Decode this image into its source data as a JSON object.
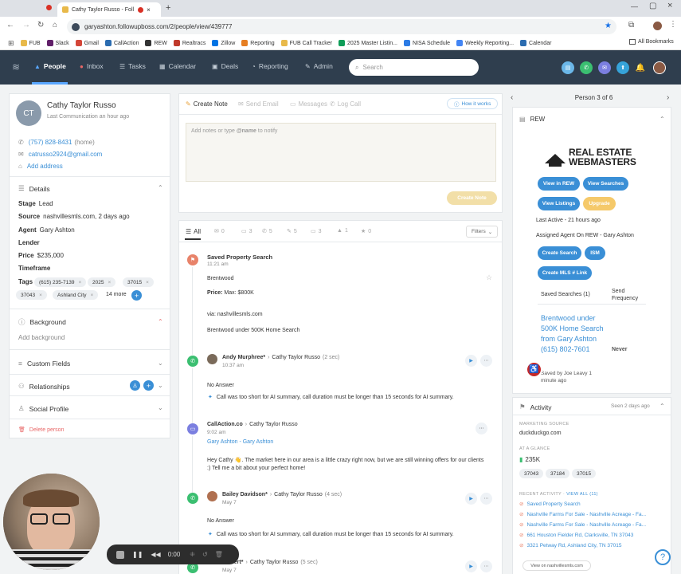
{
  "browser": {
    "tab_title": "Cathy Taylor Russo - Foll",
    "url": "garyashton.followupboss.com/2/people/view/439777",
    "bookmarks": [
      "FUB",
      "Slack",
      "Gmail",
      "CallAction",
      "REW",
      "Realtracs",
      "Zillow",
      "Reporting",
      "FUB Call Tracker",
      "2025 Master Listin...",
      "NISA Schedule",
      "Weekly Reporting...",
      "Calendar"
    ],
    "all_bookmarks": "All Bookmarks",
    "bookmark_colors": [
      "#e8b94a",
      "#611f69",
      "#d44638",
      "#2b6cb0",
      "#333",
      "#c0392b",
      "#0074e4",
      "#e67e22",
      "#e8b94a",
      "#0f9d58",
      "#2c7be5",
      "#4285f4",
      "#2b6cb0"
    ]
  },
  "nav": {
    "items": [
      "People",
      "Inbox",
      "Tasks",
      "Calendar",
      "Deals",
      "Reporting",
      "Admin"
    ],
    "search_placeholder": "Search"
  },
  "contact": {
    "initials": "CT",
    "name": "Cathy Taylor Russo",
    "last_comm": "Last Communication an hour ago",
    "phone": "(757) 828-8431",
    "phone_type": "(home)",
    "email": "catrusso2924@gmail.com",
    "add_address": "Add address"
  },
  "details": {
    "title": "Details",
    "stage_l": "Stage",
    "stage": "Lead",
    "source_l": "Source",
    "source": "nashvillesmls.com, 2 days ago",
    "agent_l": "Agent",
    "agent": "Gary Ashton",
    "lender_l": "Lender",
    "price_l": "Price",
    "price": "$235,000",
    "timeframe_l": "Timeframe",
    "tags_l": "Tags",
    "tags": [
      "(615) 235-7139",
      "2025",
      "37015",
      "37043",
      "Ashland City"
    ],
    "more": "14 more"
  },
  "sections": {
    "background": "Background",
    "add_background": "Add background",
    "custom_fields": "Custom Fields",
    "relationships": "Relationships",
    "social": "Social Profile",
    "delete": "Delete person"
  },
  "composer": {
    "tabs": [
      "Create Note",
      "Send Email",
      "Messages",
      "Log Call"
    ],
    "how": "How it works",
    "placeholder_pre": "Add notes or type ",
    "placeholder_name": "@name",
    "placeholder_post": " to notify",
    "create_btn": "Create Note"
  },
  "filters": {
    "all": "All",
    "counts": [
      "0",
      "3",
      "5",
      "5",
      "3",
      "1",
      "0"
    ],
    "filters": "Filters"
  },
  "feed": {
    "s1_title": "Saved Property Search",
    "s1_time": "11:21 am",
    "s1_area": "Brentwood",
    "s1_price_l": "Price:",
    "s1_price": "Max: $800K",
    "s1_via": "via: nashvillesmls.com",
    "s1_name": "Brentwood under 500K Home Search",
    "c1_from": "Andy Murphree*",
    "c1_to": "Cathy Taylor Russo",
    "c1_dur": "(2 sec)",
    "c1_time": "10:37 am",
    "c1_status": "No Answer",
    "c1_ai": "Call was too short for AI summary, call duration must be longer than 15 seconds for AI summary.",
    "m_from": "CallAction.co",
    "m_to": "Cathy Taylor Russo",
    "m_time": "9:02 am",
    "m_link": "Gary Ashton - Gary Ashton",
    "m_text": "Hey Cathy 👋. The market here in our area is a little crazy right now, but we are still winning offers for our clients :) Tell me a bit about your perfect home!",
    "c2_from": "Bailey Davidson*",
    "c2_to": "Cathy Taylor Russo",
    "c2_dur": "(4 sec)",
    "c2_time": "May 7",
    "c2_status": "No Answer",
    "c2_ai": "Call was too short for AI summary, call duration must be longer than 15 seconds for AI summary.",
    "c3_from": "Calvert*",
    "c3_to": "Cathy Taylor Russo",
    "c3_dur": "(5 sec)",
    "c3_time": "May 7"
  },
  "right": {
    "person_of": "Person 3 of 6",
    "rew_title": "REW",
    "logo_a": "REAL ESTATE",
    "logo_b": "WEBMASTERS",
    "btns": [
      "View in REW",
      "View Searches",
      "View Listings",
      "Upgrade",
      "Create Search",
      "ISM",
      "Create MLS # Link"
    ],
    "last_active": "Last Active - 21 hours ago",
    "assigned": "Assigned Agent On REW - Gary Ashton",
    "saved_searches": "Saved Searches (1)",
    "send_freq": "Send Frequency",
    "search_link": "Brentwood under 500K Home Search from Gary Ashton (615) 802-7601",
    "never": "Never",
    "saved_by": "Saved by Joe Leavy 1 minute ago",
    "activity": "Activity",
    "seen": "Seen 2 days ago",
    "mkt_src_l": "MARKETING SOURCE",
    "mkt_src": "duckduckgo.com",
    "glance_l": "AT A GLANCE",
    "glance_price": "235K",
    "glance_tags": [
      "37043",
      "37184",
      "37015"
    ],
    "recent_l": "RECENT ACTIVITY",
    "view_all": "VIEW ALL (11)",
    "recent": [
      "Saved Property Search",
      "Nashville Farms For Sale - Nashville Acreage - Fa...",
      "Nashville Farms For Sale - Nashville Acreage - Fa...",
      "661 Houston Fielder Rd, Clarksville, TN 37043",
      "3321 Petway Rd, Ashland City, TN 37015"
    ],
    "view_on": "View on nashvillesmls.com"
  },
  "recorder": {
    "time": "0:00"
  }
}
